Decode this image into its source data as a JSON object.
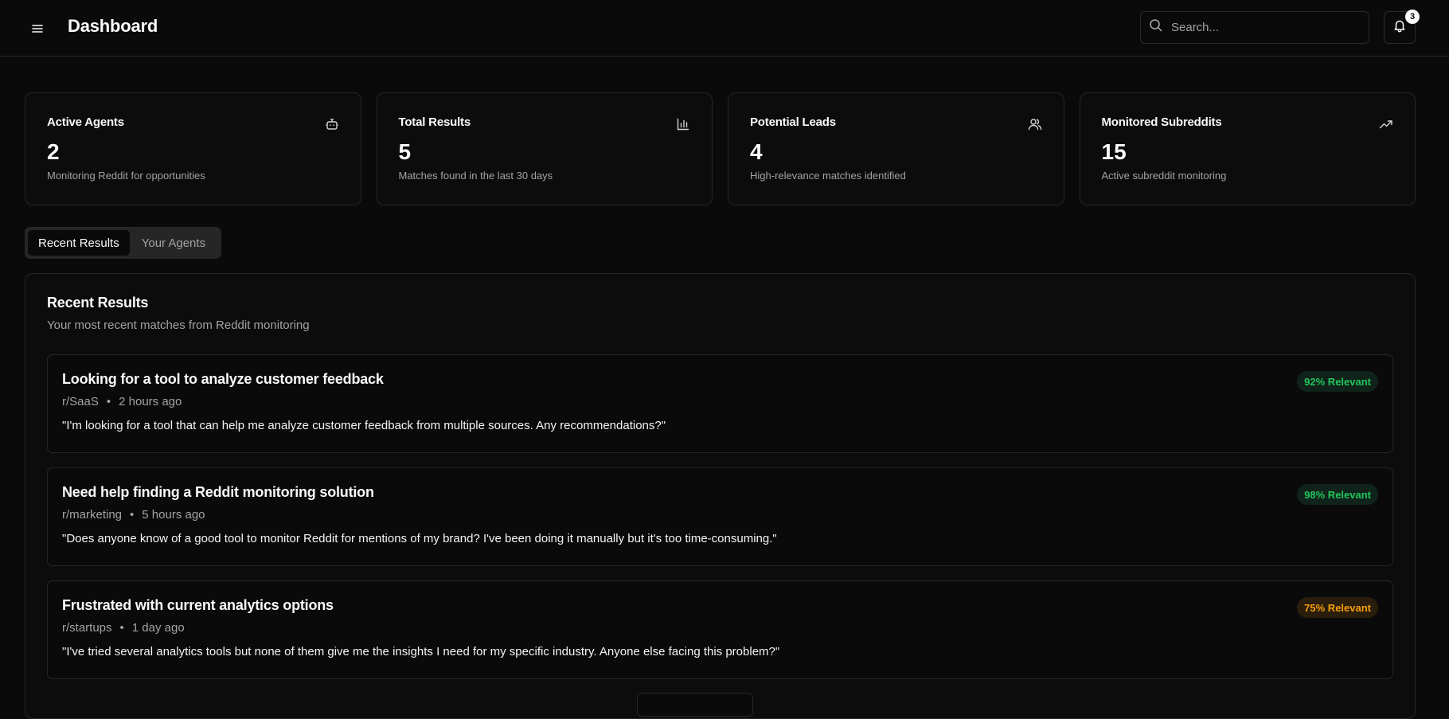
{
  "header": {
    "title": "Dashboard",
    "search_placeholder": "Search...",
    "notification_count": "3"
  },
  "stats": [
    {
      "label": "Active Agents",
      "value": "2",
      "desc": "Monitoring Reddit for opportunities",
      "icon": "bot-icon"
    },
    {
      "label": "Total Results",
      "value": "5",
      "desc": "Matches found in the last 30 days",
      "icon": "bar-chart-icon"
    },
    {
      "label": "Potential Leads",
      "value": "4",
      "desc": "High-relevance matches identified",
      "icon": "users-icon"
    },
    {
      "label": "Monitored Subreddits",
      "value": "15",
      "desc": "Active subreddit monitoring",
      "icon": "trending-up-icon"
    }
  ],
  "tabs": [
    {
      "label": "Recent Results",
      "active": true
    },
    {
      "label": "Your Agents",
      "active": false
    }
  ],
  "results": {
    "title": "Recent Results",
    "subtitle": "Your most recent matches from Reddit monitoring",
    "items": [
      {
        "title": "Looking for a tool to analyze customer feedback",
        "subreddit": "r/SaaS",
        "time": "2 hours ago",
        "quote": "\"I'm looking for a tool that can help me analyze customer feedback from multiple sources. Any recommendations?\"",
        "relevance": "92% Relevant",
        "relevance_color": "#22c55e"
      },
      {
        "title": "Need help finding a Reddit monitoring solution",
        "subreddit": "r/marketing",
        "time": "5 hours ago",
        "quote": "\"Does anyone know of a good tool to monitor Reddit for mentions of my brand? I've been doing it manually but it's too time-consuming.\"",
        "relevance": "98% Relevant",
        "relevance_color": "#22c55e"
      },
      {
        "title": "Frustrated with current analytics options",
        "subreddit": "r/startups",
        "time": "1 day ago",
        "quote": "\"I've tried several analytics tools but none of them give me the insights I need for my specific industry. Anyone else facing this problem?\"",
        "relevance": "75% Relevant",
        "relevance_color": "#f59e0b"
      }
    ]
  },
  "separator": "•"
}
